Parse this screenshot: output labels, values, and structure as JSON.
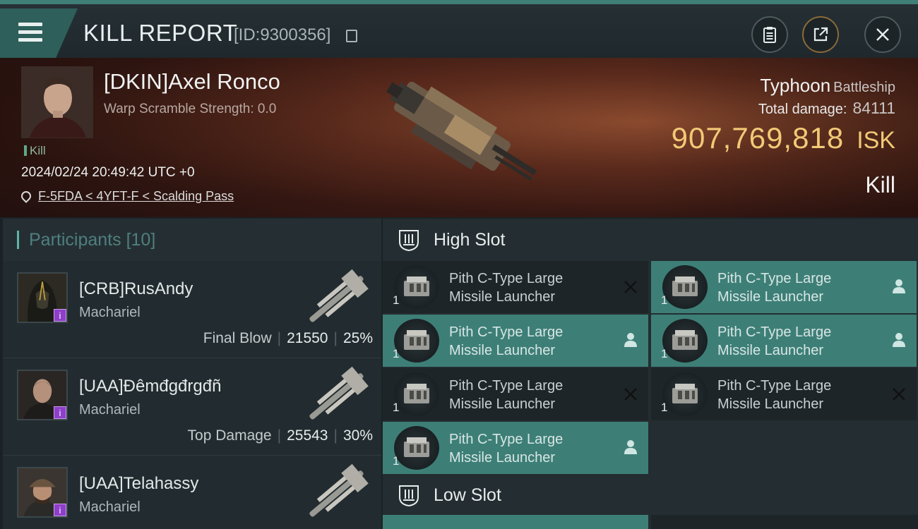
{
  "header": {
    "title": "KILL REPORT",
    "report_id": "[ID:9300356]",
    "menu_icon": "hamburger-icon",
    "buttons": [
      "clipboard-icon",
      "share-icon",
      "close-icon"
    ]
  },
  "victim": {
    "name": "[DKIN]Axel Ronco",
    "scramble": "Warp Scramble Strength: 0.0",
    "kill_tag": "Kill",
    "datetime": "2024/02/24 20:49:42 UTC +0",
    "location": "F-5FDA < 4YFT-F < Scalding Pass",
    "ship_name": "Typhoon",
    "ship_class": "Battleship",
    "total_damage_label": "Total damage:",
    "total_damage": "84111",
    "isk_value": "907,769,818",
    "isk_unit": "ISK",
    "result": "Kill"
  },
  "participants": {
    "label": "Participants",
    "count": "[10]",
    "rows": [
      {
        "name": "[CRB]RusAndy",
        "ship": "Machariel",
        "role": "Final Blow",
        "damage": "21550",
        "percent": "25%"
      },
      {
        "name": "[UAA]Đêmđgđrgđñ",
        "ship": "Machariel",
        "role": "Top Damage",
        "damage": "25543",
        "percent": "30%"
      },
      {
        "name": "[UAA]Telahassy",
        "ship": "Machariel",
        "role": "",
        "damage": "",
        "percent": ""
      }
    ]
  },
  "slots": {
    "high_label": "High Slot",
    "low_label": "Low Slot",
    "modules": [
      {
        "name_line1": "Pith C-Type Large",
        "name_line2": "Missile Launcher",
        "qty": "1",
        "status": "destroyed"
      },
      {
        "name_line1": "Pith C-Type Large",
        "name_line2": "Missile Launcher",
        "qty": "1",
        "status": "dropped"
      },
      {
        "name_line1": "Pith C-Type Large",
        "name_line2": "Missile Launcher",
        "qty": "1",
        "status": "dropped"
      },
      {
        "name_line1": "Pith C-Type Large",
        "name_line2": "Missile Launcher",
        "qty": "1",
        "status": "dropped"
      },
      {
        "name_line1": "Pith C-Type Large",
        "name_line2": "Missile Launcher",
        "qty": "1",
        "status": "destroyed"
      },
      {
        "name_line1": "Pith C-Type Large",
        "name_line2": "Missile Launcher",
        "qty": "1",
        "status": "destroyed"
      },
      {
        "name_line1": "Pith C-Type Large",
        "name_line2": "Missile Launcher",
        "qty": "1",
        "status": "dropped"
      }
    ]
  },
  "colors": {
    "accent": "#3d7f77",
    "isk": "#f2c976",
    "badge": "#8e3fc9"
  }
}
